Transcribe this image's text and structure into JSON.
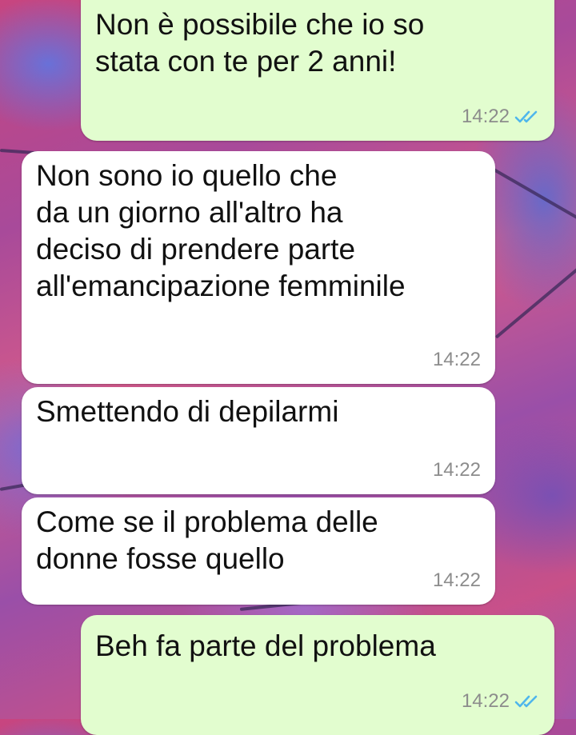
{
  "messages": [
    {
      "direction": "out",
      "lines": [
        "Non è possibile che io so",
        "stata con te per 2 anni!"
      ],
      "time": "14:22",
      "status": "read",
      "status_icon": "double-check-icon",
      "status_color": "#4fb6ec"
    },
    {
      "direction": "in",
      "lines": [
        "Non sono io quello che",
        "da un giorno all'altro ha",
        "deciso di prendere parte",
        "all'emancipazione femminile"
      ],
      "time": "14:22"
    },
    {
      "direction": "in",
      "lines": [
        "Smettendo di depilarmi"
      ],
      "time": "14:22"
    },
    {
      "direction": "in",
      "lines": [
        "Come se il problema delle",
        "donne fosse quello"
      ],
      "time": "14:22"
    },
    {
      "direction": "out",
      "lines": [
        "Beh fa parte del problema"
      ],
      "time": "14:22",
      "status": "read",
      "status_icon": "double-check-icon",
      "status_color": "#4fb6ec"
    }
  ],
  "colors": {
    "incoming_bubble": "#ffffff",
    "outgoing_bubble": "#e2fdcf",
    "timestamp": "#8c8c8c",
    "read_ticks": "#4fb6ec"
  }
}
